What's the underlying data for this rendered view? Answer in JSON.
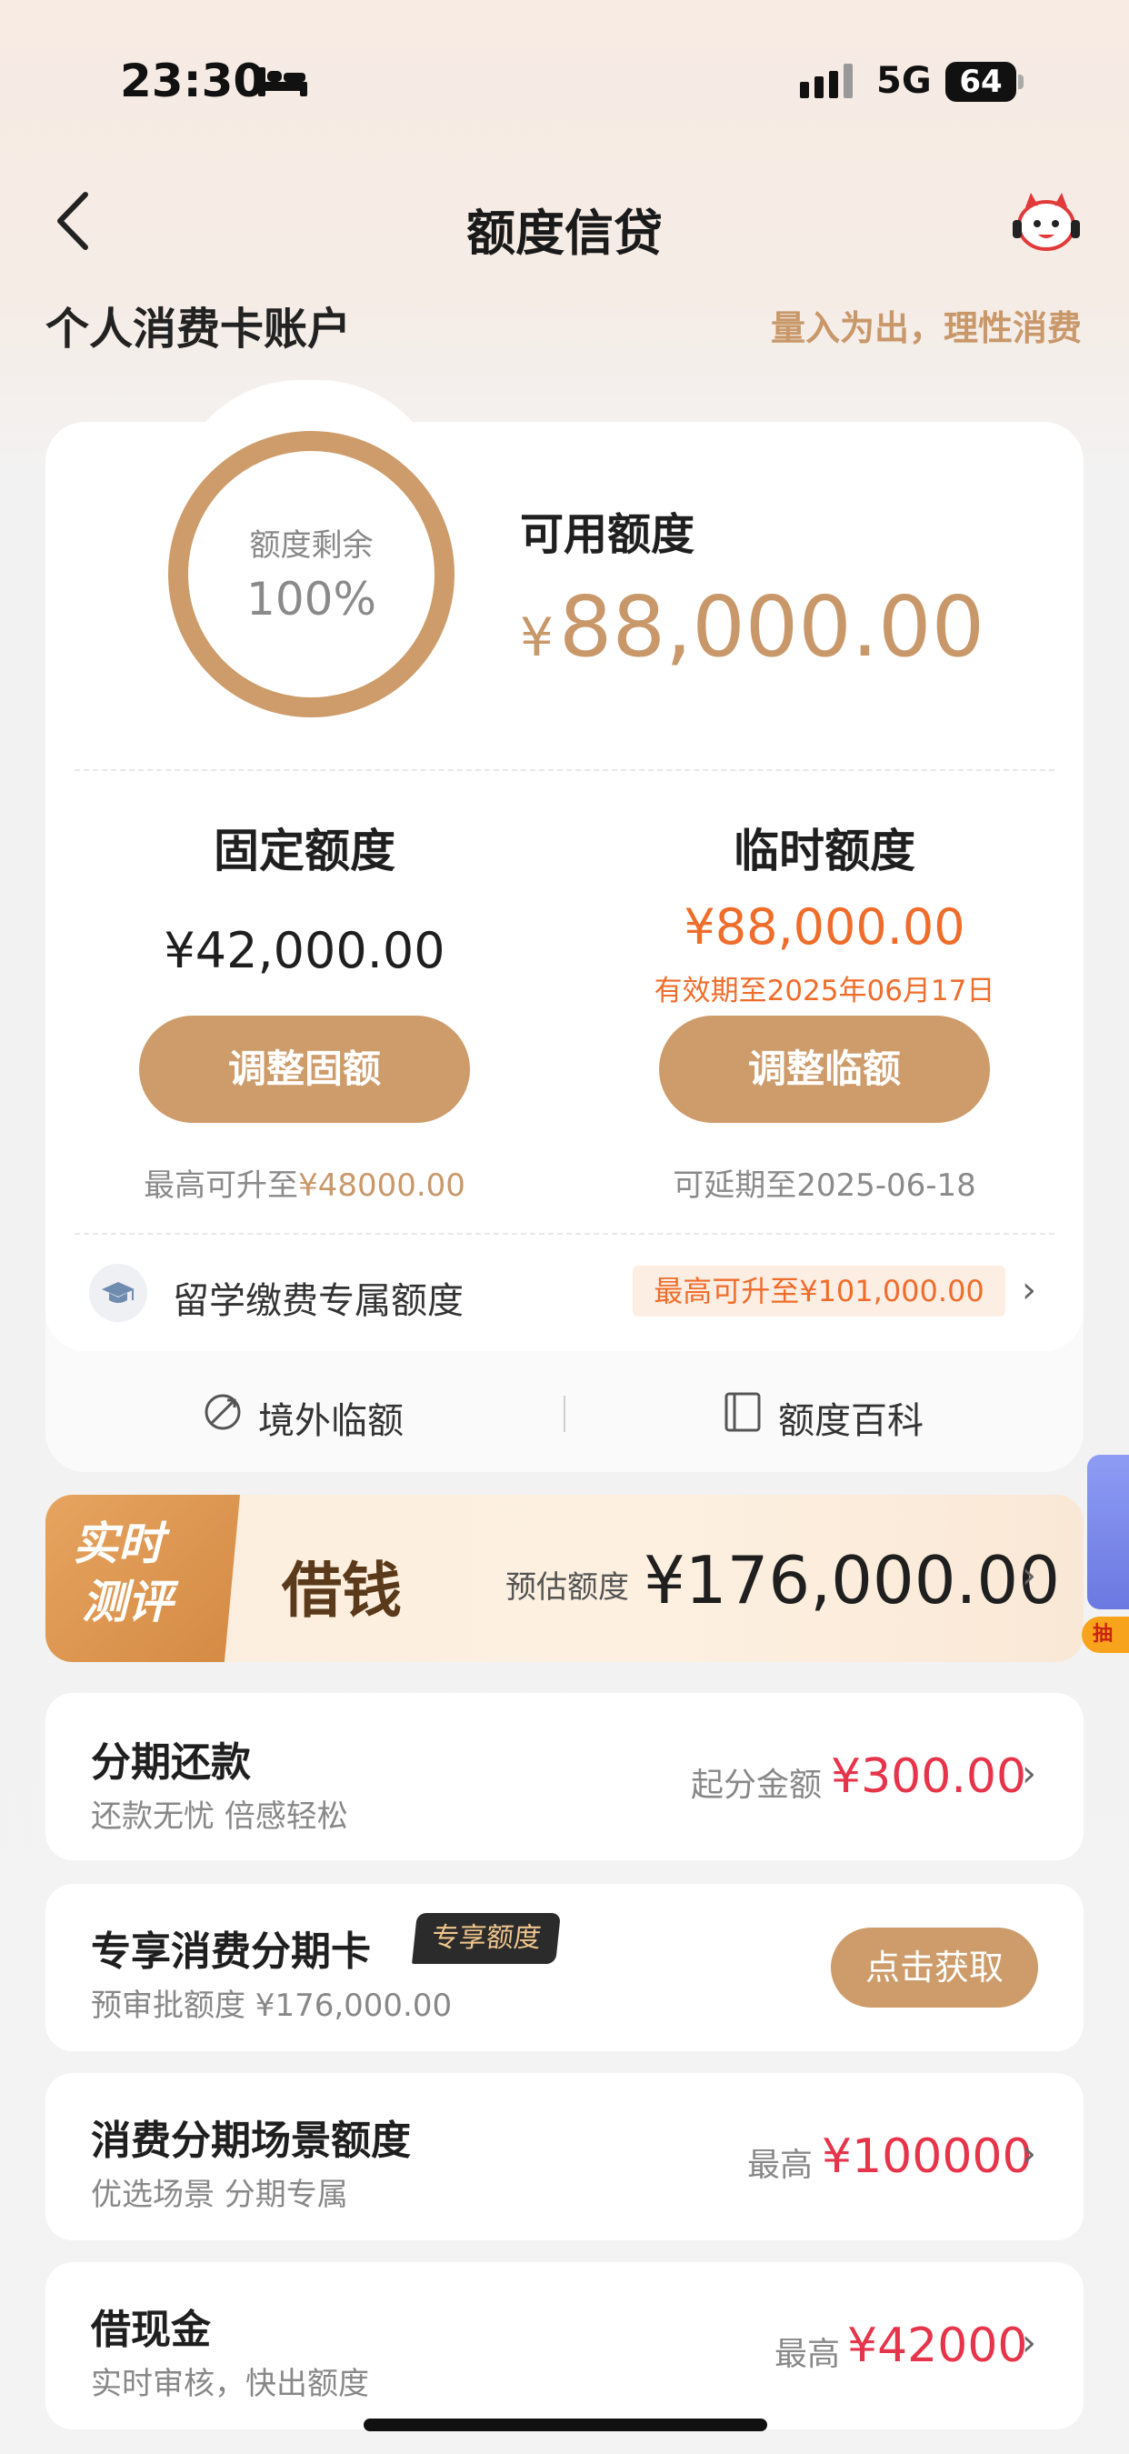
{
  "status_bar": {
    "time": "23:30",
    "network": "5G",
    "battery": "64"
  },
  "nav": {
    "title": "额度信贷"
  },
  "account": {
    "title": "个人消费卡账户",
    "slogan": "量入为出，理性消费"
  },
  "ring": {
    "label": "额度剩余",
    "percent": "100%",
    "fraction": 1.0
  },
  "available": {
    "label": "可用额度",
    "currency": "¥",
    "amount": "88,000.00"
  },
  "fixed": {
    "title": "固定额度",
    "amount": "¥42,000.00",
    "button": "调整固额",
    "hint_prefix": "最高可升至",
    "hint_value": "¥48000.00"
  },
  "temporary": {
    "title": "临时额度",
    "amount": "¥88,000.00",
    "valid": "有效期至2025年06月17日",
    "button": "调整临额",
    "hint": "可延期至2025-06-18"
  },
  "study": {
    "label": "留学缴费专属额度",
    "badge": "最高可升至¥101,000.00"
  },
  "links": {
    "overseas": "境外临额",
    "wiki": "额度百科"
  },
  "banner": {
    "tag_line1": "实时",
    "tag_line2": "测评",
    "title": "借钱",
    "est_label": "预估额度",
    "est_amount": "¥176,000.00"
  },
  "side_promo": {
    "tag": "抽"
  },
  "rows": [
    {
      "title": "分期还款",
      "sub": "还款无忧 倍感轻松",
      "right_label": "起分金额",
      "right_amount": "¥300.00"
    },
    {
      "title": "专享消费分期卡",
      "badge": "专享额度",
      "sub": "预审批额度 ¥176,000.00",
      "button": "点击获取"
    },
    {
      "title": "消费分期场景额度",
      "sub": "优选场景 分期专属",
      "right_label": "最高",
      "right_amount": "¥100000"
    },
    {
      "title": "借现金",
      "sub": "实时审核，快出额度",
      "right_label": "最高",
      "right_amount": "¥42000"
    }
  ],
  "colors": {
    "gold": "#cd9c6a",
    "orange": "#ef6d2b",
    "red": "#e6344a"
  }
}
